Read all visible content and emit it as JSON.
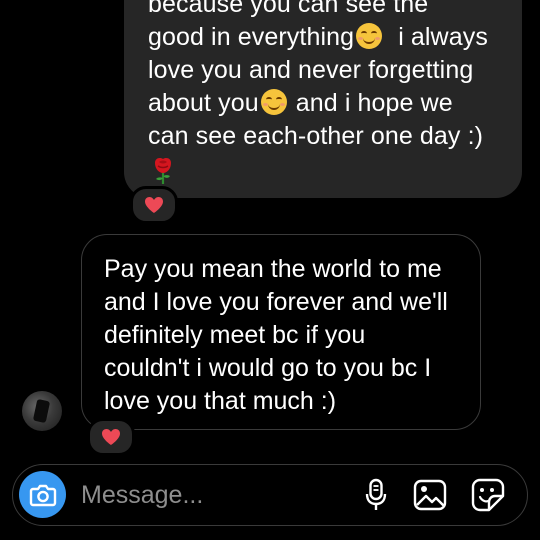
{
  "thread": {
    "sent_message": {
      "lines": [
        "because you can see the",
        "good in everything",
        "i always",
        "love you and never forgetting",
        "about you",
        "and i hope we",
        "can see each-other one day :)"
      ],
      "emojis": [
        "relieved-face",
        "smiling-face",
        "rose"
      ],
      "reaction": "red-heart"
    },
    "received_message": {
      "lines": [
        "Pay you mean the world to me",
        "and I love you forever and we'll",
        "definitely meet bc if you",
        "couldn't i would go to you bc I",
        "love you that much :)"
      ],
      "reaction": "red-heart"
    }
  },
  "composer": {
    "placeholder": "Message...",
    "icons": [
      "camera-icon",
      "microphone-icon",
      "gallery-icon",
      "sticker-icon"
    ]
  },
  "colors": {
    "background": "#000000",
    "sent_bubble": "#262626",
    "camera_button": "#3797f0",
    "heart": "#ed4956",
    "placeholder_text": "#8e8e8e"
  }
}
